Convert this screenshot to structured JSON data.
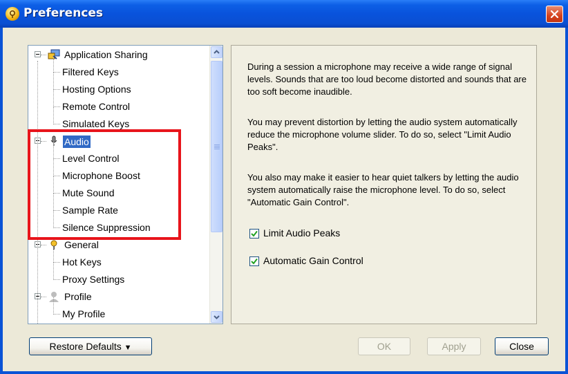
{
  "window": {
    "title": "Preferences"
  },
  "tree": {
    "items": [
      {
        "label": "Application Sharing",
        "level": 0,
        "icon": "app-sharing-icon"
      },
      {
        "label": "Filtered Keys",
        "level": 1
      },
      {
        "label": "Hosting Options",
        "level": 1
      },
      {
        "label": "Remote Control",
        "level": 1
      },
      {
        "label": "Simulated Keys",
        "level": 1
      },
      {
        "label": "Audio",
        "level": 0,
        "icon": "microphone-icon",
        "selected": true
      },
      {
        "label": "Level Control",
        "level": 1
      },
      {
        "label": "Microphone Boost",
        "level": 1
      },
      {
        "label": "Mute Sound",
        "level": 1
      },
      {
        "label": "Sample Rate",
        "level": 1
      },
      {
        "label": "Silence Suppression",
        "level": 1
      },
      {
        "label": "General",
        "level": 0,
        "icon": "general-icon"
      },
      {
        "label": "Hot Keys",
        "level": 1
      },
      {
        "label": "Proxy Settings",
        "level": 1
      },
      {
        "label": "Profile",
        "level": 0,
        "icon": "profile-icon"
      },
      {
        "label": "My Profile",
        "level": 1
      }
    ]
  },
  "pane": {
    "paragraphs": [
      "During a session a microphone may receive a wide range of signal levels. Sounds that are too loud become distorted and sounds that are too soft become inaudible.",
      "You may prevent distortion by letting the audio system automatically reduce the microphone volume slider. To do so, select \"Limit Audio Peaks\".",
      "You also may make it easier to hear quiet talkers by letting the audio system automatically raise the microphone level. To do so, select \"Automatic Gain Control\"."
    ],
    "limit_audio_peaks": {
      "label": "Limit Audio Peaks",
      "checked": true
    },
    "automatic_gain_control": {
      "label": "Automatic Gain Control",
      "checked": true
    }
  },
  "buttons": {
    "restore_defaults": "Restore Defaults",
    "ok": "OK",
    "apply": "Apply",
    "close": "Close"
  },
  "colors": {
    "selection": "#316ac5",
    "highlight_box": "#e8141b",
    "titlebar": "#0953dc"
  }
}
